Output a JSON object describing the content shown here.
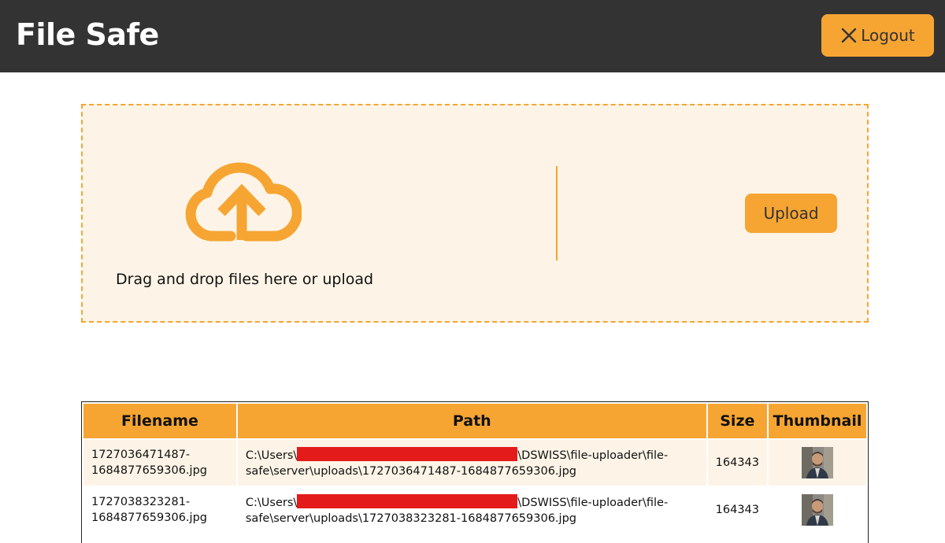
{
  "header": {
    "title": "File Safe",
    "logout_label": "Logout",
    "accent_color": "#f6a533",
    "bar_color": "#333333"
  },
  "dropzone": {
    "hint": "Drag and drop files here or upload",
    "upload_label": "Upload",
    "icon": "cloud-upload-icon",
    "background": "#fdf4e7"
  },
  "table": {
    "headers": [
      "Filename",
      "Path",
      "Size",
      "Thumbnail"
    ],
    "rows": [
      {
        "filename": "1727036471487-1684877659306.jpg",
        "path_prefix": "C:\\Users\\",
        "path_suffix": "\\DSWISS\\file-uploader\\file-safe\\server\\uploads\\1727036471487-1684877659306.jpg",
        "size": "164343",
        "thumbnail": "person-photo"
      },
      {
        "filename": "1727038323281-1684877659306.jpg",
        "path_prefix": "C:\\Users\\",
        "path_suffix": "\\DSWISS\\file-uploader\\file-safe\\server\\uploads\\1727038323281-1684877659306.jpg",
        "size": "164343",
        "thumbnail": "person-photo"
      }
    ]
  }
}
